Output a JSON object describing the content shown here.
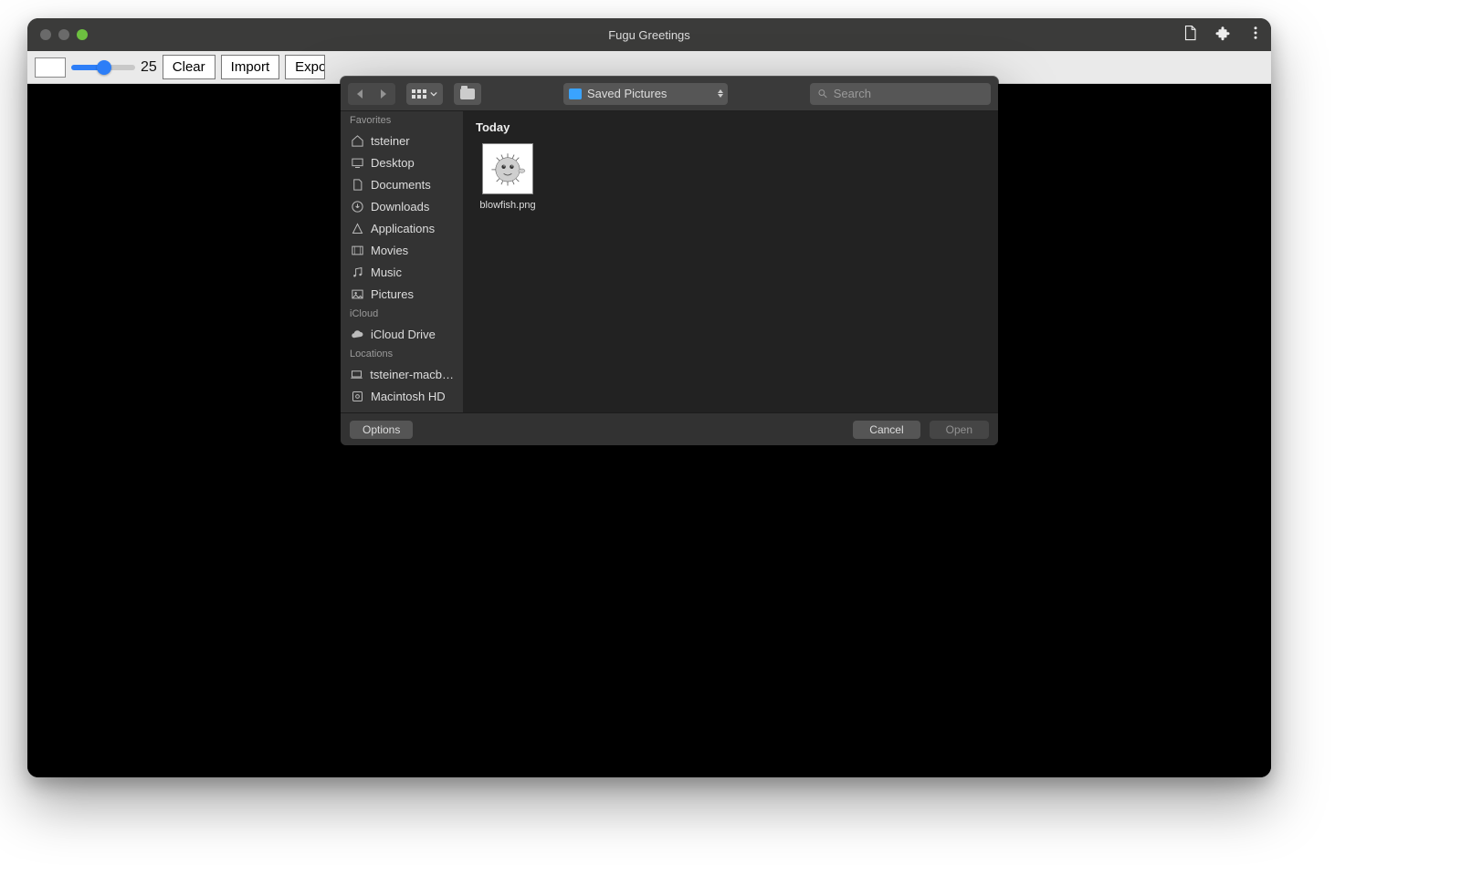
{
  "window": {
    "title": "Fugu Greetings"
  },
  "app_toolbar": {
    "slider_value": "25",
    "clear_label": "Clear",
    "import_label": "Import",
    "export_label": "Export"
  },
  "file_dialog": {
    "location": "Saved Pictures",
    "search_placeholder": "Search",
    "sections": [
      {
        "header": "Favorites",
        "items": [
          {
            "icon": "home",
            "label": "tsteiner"
          },
          {
            "icon": "desktop",
            "label": "Desktop"
          },
          {
            "icon": "doc",
            "label": "Documents"
          },
          {
            "icon": "download",
            "label": "Downloads"
          },
          {
            "icon": "apps",
            "label": "Applications"
          },
          {
            "icon": "movie",
            "label": "Movies"
          },
          {
            "icon": "music",
            "label": "Music"
          },
          {
            "icon": "pictures",
            "label": "Pictures"
          }
        ]
      },
      {
        "header": "iCloud",
        "items": [
          {
            "icon": "cloud",
            "label": "iCloud Drive"
          }
        ]
      },
      {
        "header": "Locations",
        "items": [
          {
            "icon": "laptop",
            "label": "tsteiner-macb…"
          },
          {
            "icon": "disk",
            "label": "Macintosh HD"
          }
        ]
      }
    ],
    "content_header": "Today",
    "files": [
      {
        "name": "blowfish.png"
      }
    ],
    "options_label": "Options",
    "cancel_label": "Cancel",
    "open_label": "Open"
  }
}
